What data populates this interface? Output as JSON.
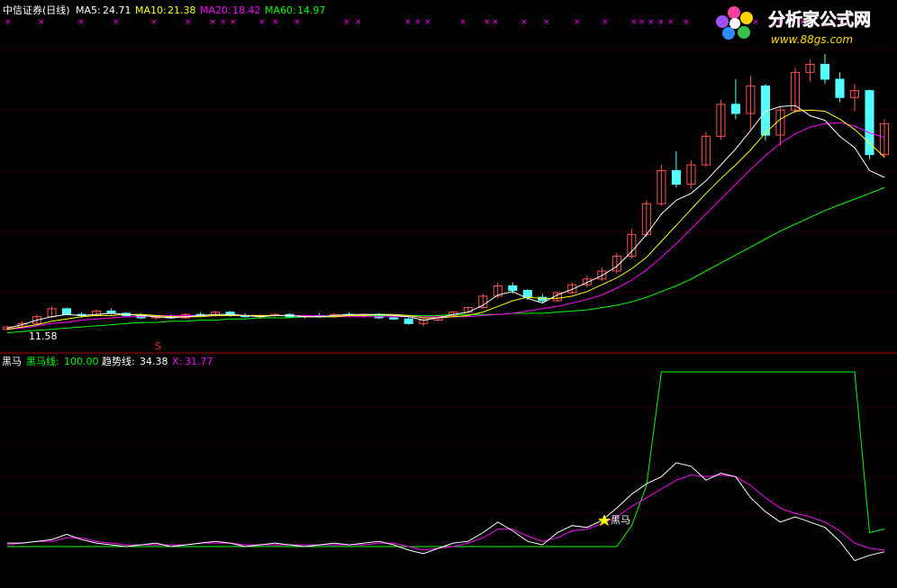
{
  "top_panel": {
    "stock": "中信证券(日线)",
    "ma5_label": "MA5:",
    "ma5_value": "24.71",
    "ma10_label": "MA10:",
    "ma10_value": "21.38",
    "ma20_label": "MA20:",
    "ma20_value": "18.42",
    "ma60_label": "MA60:",
    "ma60_value": "14.97",
    "low_price_label": "11.58",
    "s_marker": "S"
  },
  "bottom_panel": {
    "indicator": "黑马",
    "hm_label": "黑马线:",
    "hm_value": "100.00",
    "trend_label": "趋势线:",
    "trend_value": "34.38",
    "x_label": "X:",
    "x_value": "31.77",
    "signal_label": "黑马"
  },
  "logo": {
    "name": "分析家公式网",
    "url": "www.88gs.com"
  },
  "colors": {
    "up": "#ff5050",
    "down": "#54ffff",
    "ma5": "#ffffff",
    "ma10": "#ffff00",
    "ma20": "#ff00ff",
    "ma60": "#00ff00",
    "grid": "#7a0000",
    "separator": "#b00000",
    "star": "#ffff00"
  },
  "chart_data": [
    {
      "type": "candlestick",
      "title": "中信证券(日线)",
      "series": [
        {
          "name": "MA5",
          "last": 24.71,
          "values": [
            11.6,
            11.9,
            12.3,
            12.6,
            12.8,
            12.7,
            12.8,
            12.9,
            12.8,
            12.7,
            12.6,
            12.5,
            12.6,
            12.7,
            12.8,
            12.8,
            12.7,
            12.6,
            12.7,
            12.7,
            12.6,
            12.6,
            12.7,
            12.8,
            12.8,
            12.8,
            12.7,
            12.6,
            12.3,
            12.5,
            12.8,
            13.0,
            13.6,
            14.5,
            14.8,
            14.2,
            13.8,
            14.5,
            15.0,
            15.6,
            16.2,
            17.0,
            18.3,
            19.8,
            21.6,
            22.8,
            23.4,
            24.5,
            25.9,
            27.3,
            28.9,
            30.6,
            31.0,
            31.1,
            30.2,
            29.8,
            28.4,
            27.4,
            25.4,
            24.8
          ]
        },
        {
          "name": "MA10",
          "last": 21.38,
          "values": [
            11.5,
            11.7,
            11.9,
            12.2,
            12.4,
            12.6,
            12.7,
            12.7,
            12.8,
            12.8,
            12.7,
            12.6,
            12.6,
            12.6,
            12.7,
            12.7,
            12.7,
            12.7,
            12.7,
            12.7,
            12.6,
            12.6,
            12.6,
            12.7,
            12.7,
            12.8,
            12.8,
            12.7,
            12.5,
            12.5,
            12.6,
            12.7,
            13.0,
            13.5,
            14.0,
            14.3,
            14.2,
            14.2,
            14.4,
            14.8,
            15.4,
            16.0,
            16.8,
            17.8,
            19.2,
            20.6,
            22.0,
            23.4,
            24.7,
            25.9,
            27.2,
            28.7,
            29.9,
            30.6,
            30.7,
            30.6,
            29.9,
            29.0,
            27.8,
            26.6
          ]
        },
        {
          "name": "MA20",
          "last": 18.42,
          "values": [
            11.5,
            11.6,
            11.8,
            12.0,
            12.1,
            12.3,
            12.4,
            12.5,
            12.6,
            12.6,
            12.7,
            12.7,
            12.7,
            12.7,
            12.7,
            12.7,
            12.7,
            12.7,
            12.7,
            12.7,
            12.7,
            12.7,
            12.6,
            12.6,
            12.6,
            12.6,
            12.6,
            12.6,
            12.6,
            12.6,
            12.6,
            12.6,
            12.7,
            12.8,
            12.9,
            13.1,
            13.3,
            13.5,
            13.8,
            14.1,
            14.5,
            15.1,
            15.8,
            16.7,
            17.8,
            19.0,
            20.3,
            21.6,
            22.9,
            24.2,
            25.5,
            26.7,
            27.8,
            28.6,
            29.2,
            29.5,
            29.6,
            29.3,
            28.7,
            28.3
          ]
        },
        {
          "name": "MA60",
          "last": 14.97,
          "values": [
            11.2,
            11.3,
            11.4,
            11.5,
            11.6,
            11.7,
            11.8,
            11.9,
            12.0,
            12.1,
            12.1,
            12.2,
            12.2,
            12.3,
            12.3,
            12.4,
            12.4,
            12.5,
            12.5,
            12.5,
            12.6,
            12.6,
            12.6,
            12.7,
            12.7,
            12.7,
            12.7,
            12.7,
            12.7,
            12.7,
            12.8,
            12.8,
            12.8,
            12.8,
            12.9,
            12.9,
            12.9,
            13.0,
            13.1,
            13.2,
            13.4,
            13.6,
            13.9,
            14.3,
            14.8,
            15.3,
            15.9,
            16.6,
            17.3,
            18.0,
            18.7,
            19.4,
            20.1,
            20.7,
            21.3,
            21.9,
            22.4,
            22.9,
            23.4,
            23.9
          ]
        }
      ],
      "ohlc": [
        [
          11.5,
          11.8,
          11.4,
          11.7
        ],
        [
          11.7,
          12.2,
          11.6,
          12.0
        ],
        [
          12.0,
          12.8,
          11.9,
          12.6
        ],
        [
          12.6,
          13.5,
          12.5,
          13.3
        ],
        [
          13.3,
          13.4,
          12.7,
          12.8
        ],
        [
          12.8,
          13.0,
          12.5,
          12.7
        ],
        [
          12.7,
          13.2,
          12.6,
          13.1
        ],
        [
          13.1,
          13.3,
          12.8,
          12.9
        ],
        [
          12.9,
          13.0,
          12.6,
          12.7
        ],
        [
          12.7,
          12.9,
          12.4,
          12.5
        ],
        [
          12.5,
          12.7,
          12.3,
          12.6
        ],
        [
          12.6,
          12.8,
          12.4,
          12.5
        ],
        [
          12.5,
          12.9,
          12.4,
          12.8
        ],
        [
          12.8,
          13.0,
          12.6,
          12.7
        ],
        [
          12.7,
          13.1,
          12.6,
          13.0
        ],
        [
          13.0,
          13.1,
          12.6,
          12.7
        ],
        [
          12.7,
          12.9,
          12.5,
          12.6
        ],
        [
          12.6,
          12.8,
          12.4,
          12.7
        ],
        [
          12.7,
          12.9,
          12.5,
          12.8
        ],
        [
          12.8,
          12.9,
          12.5,
          12.6
        ],
        [
          12.6,
          12.8,
          12.4,
          12.7
        ],
        [
          12.7,
          12.9,
          12.5,
          12.6
        ],
        [
          12.6,
          12.9,
          12.5,
          12.8
        ],
        [
          12.8,
          13.0,
          12.6,
          12.7
        ],
        [
          12.7,
          12.9,
          12.5,
          12.8
        ],
        [
          12.8,
          12.9,
          12.4,
          12.5
        ],
        [
          12.5,
          12.7,
          12.3,
          12.4
        ],
        [
          12.4,
          12.6,
          11.9,
          12.0
        ],
        [
          12.0,
          12.4,
          11.8,
          12.3
        ],
        [
          12.3,
          12.8,
          12.2,
          12.7
        ],
        [
          12.7,
          13.1,
          12.6,
          13.0
        ],
        [
          13.0,
          13.5,
          12.9,
          13.4
        ],
        [
          13.4,
          14.6,
          13.3,
          14.4
        ],
        [
          14.4,
          15.6,
          14.2,
          15.3
        ],
        [
          15.3,
          15.6,
          14.6,
          14.9
        ],
        [
          14.9,
          15.0,
          14.1,
          14.3
        ],
        [
          14.3,
          14.6,
          13.8,
          14.0
        ],
        [
          14.0,
          14.8,
          13.9,
          14.7
        ],
        [
          14.7,
          15.6,
          14.6,
          15.4
        ],
        [
          15.4,
          16.2,
          15.2,
          15.9
        ],
        [
          15.9,
          16.9,
          15.7,
          16.6
        ],
        [
          16.6,
          18.2,
          16.4,
          17.9
        ],
        [
          17.9,
          20.3,
          17.7,
          19.8
        ],
        [
          19.8,
          22.8,
          19.6,
          22.5
        ],
        [
          22.5,
          25.9,
          22.3,
          25.4
        ],
        [
          25.4,
          27.1,
          23.9,
          24.2
        ],
        [
          24.2,
          26.3,
          23.8,
          25.9
        ],
        [
          25.9,
          28.8,
          25.7,
          28.4
        ],
        [
          28.4,
          31.6,
          28.1,
          31.2
        ],
        [
          31.2,
          33.4,
          29.9,
          30.4
        ],
        [
          30.4,
          33.7,
          29.0,
          32.8
        ],
        [
          32.8,
          33.0,
          28.0,
          28.5
        ],
        [
          28.5,
          31.0,
          27.6,
          30.7
        ],
        [
          30.7,
          34.4,
          30.4,
          34.0
        ],
        [
          34.0,
          35.1,
          33.2,
          34.7
        ],
        [
          34.7,
          35.6,
          33.0,
          33.4
        ],
        [
          33.4,
          34.0,
          31.4,
          31.8
        ],
        [
          31.8,
          33.0,
          30.6,
          32.4
        ],
        [
          32.4,
          32.5,
          26.4,
          26.8
        ],
        [
          26.8,
          29.9,
          26.5,
          29.5
        ]
      ],
      "annotations": [
        "11.58",
        "S"
      ]
    },
    {
      "type": "line",
      "title": "黑马",
      "series": [
        {
          "name": "黑马线",
          "last": 100.0,
          "values": [
            0,
            0,
            0,
            0,
            0,
            0,
            0,
            0,
            0,
            0,
            0,
            0,
            0,
            0,
            0,
            0,
            0,
            0,
            0,
            0,
            0,
            0,
            0,
            0,
            0,
            0,
            0,
            0,
            0,
            0,
            0,
            0,
            0,
            0,
            0,
            0,
            0,
            0,
            0,
            0,
            0,
            0,
            12,
            35,
            100,
            100,
            100,
            100,
            100,
            100,
            100,
            100,
            100,
            100,
            100,
            100,
            100,
            100,
            8,
            10
          ]
        },
        {
          "name": "趋势线",
          "last": 34.38,
          "values": [
            2,
            2,
            3,
            4,
            7,
            4,
            2,
            1,
            0,
            1,
            2,
            0,
            1,
            2,
            3,
            2,
            0,
            1,
            2,
            1,
            0,
            1,
            2,
            1,
            2,
            3,
            1,
            -2,
            -4,
            -1,
            2,
            3,
            8,
            14,
            9,
            3,
            1,
            8,
            12,
            11,
            15,
            22,
            30,
            36,
            40,
            48,
            46,
            38,
            42,
            40,
            28,
            20,
            14,
            17,
            14,
            11,
            3,
            -8,
            -5,
            -3
          ]
        },
        {
          "name": "X",
          "last": 31.77,
          "values": [
            1,
            2,
            3,
            3,
            5,
            5,
            3,
            2,
            1,
            1,
            1,
            1,
            1,
            2,
            2,
            2,
            1,
            1,
            1,
            1,
            1,
            1,
            1,
            1,
            1,
            2,
            2,
            0,
            -2,
            -1,
            0,
            2,
            5,
            10,
            10,
            6,
            3,
            5,
            9,
            10,
            13,
            17,
            23,
            28,
            33,
            38,
            41,
            40,
            41,
            40,
            35,
            28,
            22,
            19,
            17,
            14,
            9,
            2,
            -1,
            -2
          ]
        }
      ],
      "annotations": [
        "黑马"
      ]
    }
  ]
}
